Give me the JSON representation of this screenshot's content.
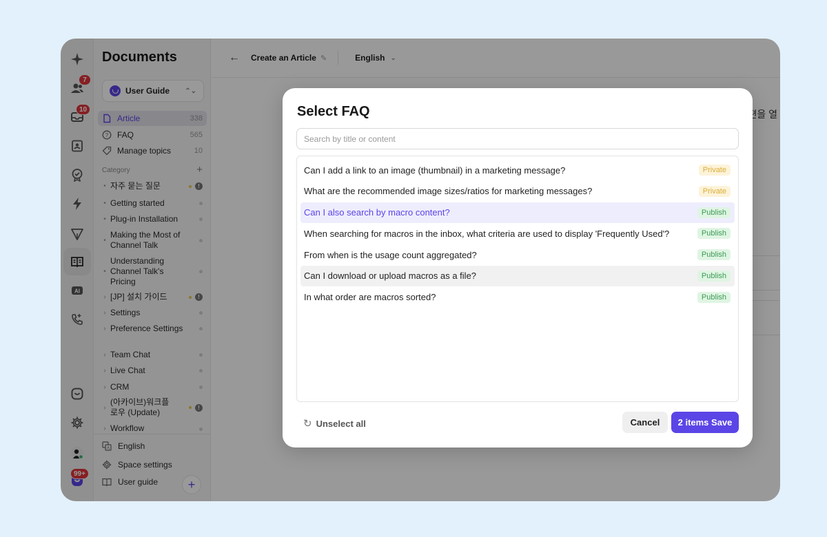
{
  "rail": {
    "badges": {
      "contacts": "7",
      "inbox": "10",
      "notifications": "99+"
    }
  },
  "sidebar": {
    "title": "Documents",
    "space": {
      "name": "User Guide"
    },
    "nav": [
      {
        "label": "Article",
        "count": "338"
      },
      {
        "label": "FAQ",
        "count": "565"
      },
      {
        "label": "Manage topics",
        "count": "10"
      }
    ],
    "category_label": "Category",
    "categories": [
      "자주 묻는 질문",
      "Getting started",
      "Plug-in Installation",
      "Making the Most of Channel Talk",
      "Understanding Channel Talk's Pricing",
      "[JP] 설치 가이드",
      "Settings",
      "Preference Settings",
      "Team Chat",
      "Live Chat",
      "CRM",
      "(아카이브)워크플로우 (Update)",
      "Workflow"
    ],
    "bottom": {
      "language": "English",
      "space_settings": "Space settings",
      "user_guide": "User guide"
    }
  },
  "topbar": {
    "title": "Create an Article",
    "language": "English"
  },
  "background": {
    "partial_text": "편을 열"
  },
  "modal": {
    "title": "Select FAQ",
    "search_placeholder": "Search by title or content",
    "items": [
      {
        "title": "Can I add a link to an image (thumbnail) in a marketing message?",
        "status": "Private"
      },
      {
        "title": "What are the recommended image sizes/ratios for marketing messages?",
        "status": "Private"
      },
      {
        "title": "Can I also search by macro content?",
        "status": "Publish"
      },
      {
        "title": "When searching for macros in the inbox, what criteria are used to display 'Frequently Used'?",
        "status": "Publish"
      },
      {
        "title": "From when is the usage count aggregated?",
        "status": "Publish"
      },
      {
        "title": "Can I download or upload macros as a file?",
        "status": "Publish"
      },
      {
        "title": "In what order are macros sorted?",
        "status": "Publish"
      }
    ],
    "unselect_label": "Unselect all",
    "cancel_label": "Cancel",
    "save_label": "2 items Save"
  },
  "colors": {
    "accent": "#5b45e6",
    "badge_red": "#e0353b",
    "private": "#d9ad38",
    "publish": "#3c9a55"
  }
}
